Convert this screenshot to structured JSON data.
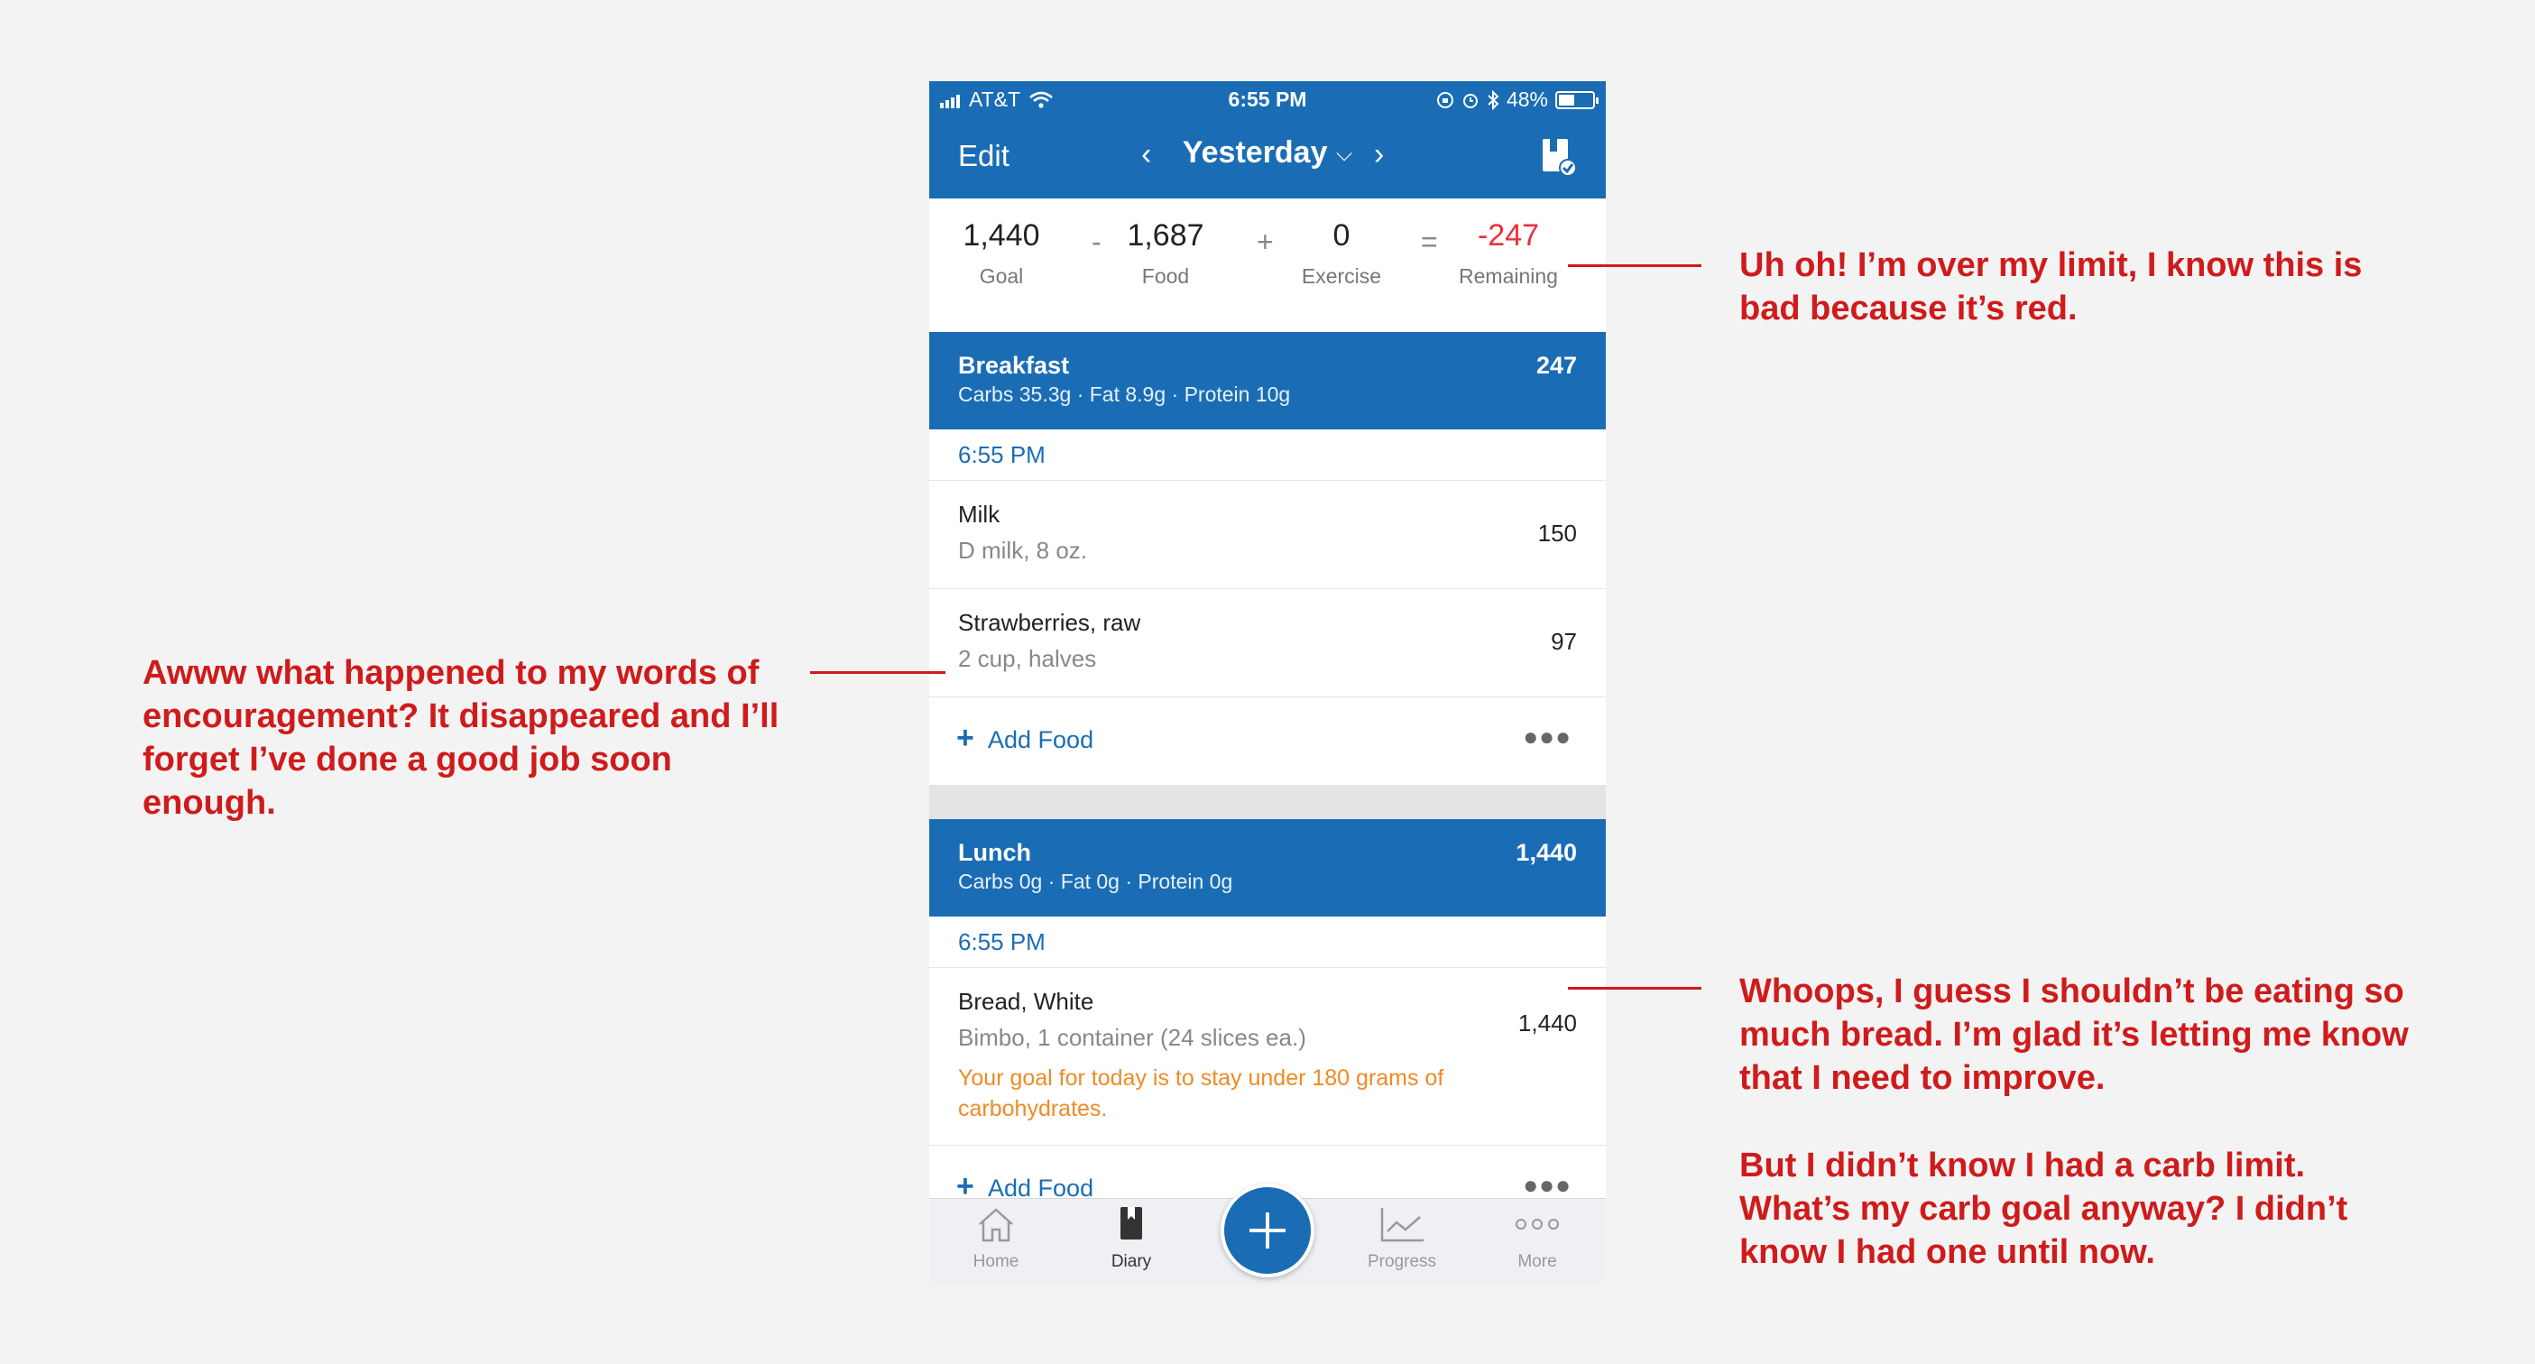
{
  "status_bar": {
    "carrier": "AT&T",
    "time": "6:55 PM",
    "battery": "48%",
    "battery_level": 0.48
  },
  "nav": {
    "edit_label": "Edit",
    "title": "Yesterday",
    "prev_icon": "chevron-left-icon",
    "next_icon": "chevron-right-icon",
    "dropdown_icon": "chevron-down-icon",
    "right_icon": "diary-complete-icon"
  },
  "summary": {
    "goal": {
      "value": "1,440",
      "label": "Goal"
    },
    "op1": "-",
    "food": {
      "value": "1,687",
      "label": "Food"
    },
    "op2": "+",
    "exercise": {
      "value": "0",
      "label": "Exercise"
    },
    "op3": "=",
    "remaining": {
      "value": "-247",
      "label": "Remaining"
    }
  },
  "breakfast": {
    "name": "Breakfast",
    "macros": "Carbs 35.3g · Fat 8.9g · Protein 10g",
    "calories": "247",
    "time": "6:55 PM",
    "items": [
      {
        "name": "Milk",
        "desc": "D milk, 8 oz.",
        "calories": "150"
      },
      {
        "name": "Strawberries, raw",
        "desc": "2 cup, halves",
        "calories": "97"
      }
    ],
    "add_food": "Add Food"
  },
  "lunch": {
    "name": "Lunch",
    "macros": "Carbs 0g · Fat 0g · Protein 0g",
    "calories": "1,440",
    "time": "6:55 PM",
    "items": [
      {
        "name": "Bread, White",
        "desc": "Bimbo, 1 container (24 slices ea.)",
        "calories": "1,440",
        "note": "Your goal for today is to stay under 180 grams of carbohydrates."
      }
    ],
    "add_food": "Add Food"
  },
  "tabs": [
    {
      "label": "Home",
      "icon": "home-icon"
    },
    {
      "label": "Diary",
      "icon": "diary-icon"
    },
    {
      "label": "Progress",
      "icon": "progress-chart-icon"
    },
    {
      "label": "More",
      "icon": "more-icon"
    }
  ],
  "callouts": {
    "top_right": "Uh oh! I’m over my limit, I know this is bad because it’s red.",
    "left": "Awww what happened to my words of encouragement? It disappeared and I’ll forget I’ve done a good job soon enough.",
    "bottom_right_1": "Whoops, I guess I shouldn’t be eating so much bread. I’m glad it’s letting me know that I need to improve.",
    "bottom_right_2": "But I didn’t know I had a carb limit. What’s my carb goal anyway? I didn’t know I had one until now."
  },
  "colors": {
    "brand_blue": "#1a6db4",
    "over_limit_red": "#e8323c",
    "note_orange": "#f08a24",
    "callout_red": "#cf1b1b",
    "background": "#f3f3f3"
  }
}
